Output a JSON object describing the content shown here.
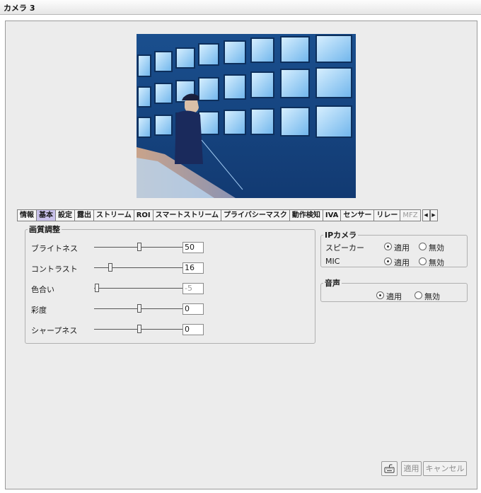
{
  "window": {
    "title": "カメラ 3"
  },
  "tabs": [
    {
      "label": "情報",
      "active": false
    },
    {
      "label": "基本",
      "active": true
    },
    {
      "label": "設定",
      "active": false
    },
    {
      "label": "露出",
      "active": false
    },
    {
      "label": "ストリーム",
      "active": false
    },
    {
      "label": "ROI",
      "active": false
    },
    {
      "label": "スマートストリーム",
      "active": false
    },
    {
      "label": "プライバシーマスク",
      "active": false
    },
    {
      "label": "動作検知",
      "active": false
    },
    {
      "label": "IVA",
      "active": false
    },
    {
      "label": "センサー",
      "active": false
    },
    {
      "label": "リレー",
      "active": false
    },
    {
      "label": "MFZ",
      "active": false
    }
  ],
  "image_adjust": {
    "title": "画質調整",
    "rows": [
      {
        "label": "ブライトネス",
        "value": "50",
        "level": 0.5,
        "enabled": true
      },
      {
        "label": "コントラスト",
        "value": "16",
        "level": 0.16,
        "enabled": true
      },
      {
        "label": "色合い",
        "value": "-5",
        "level": 0.0,
        "enabled": false
      },
      {
        "label": "彩度",
        "value": "0",
        "level": 0.5,
        "enabled": true
      },
      {
        "label": "シャープネス",
        "value": "0",
        "level": 0.5,
        "enabled": true
      }
    ]
  },
  "ip_camera": {
    "title": "IPカメラ",
    "speaker_label": "スピーカー",
    "mic_label": "MIC",
    "apply_label": "適用",
    "disable_label": "無効",
    "speaker_selected": "apply",
    "mic_selected": "apply"
  },
  "audio": {
    "title": "音声",
    "apply_label": "適用",
    "disable_label": "無効",
    "selected": "apply"
  },
  "buttons": {
    "apply": "適用",
    "cancel": "キャンセル"
  },
  "icons": {
    "keyboard": "keyboard-icon",
    "scroll_left": "arrow-left-icon",
    "scroll_right": "arrow-right-icon"
  },
  "colors": {
    "active_tab": "#c9c1ea",
    "panel_bg": "#ececec"
  }
}
